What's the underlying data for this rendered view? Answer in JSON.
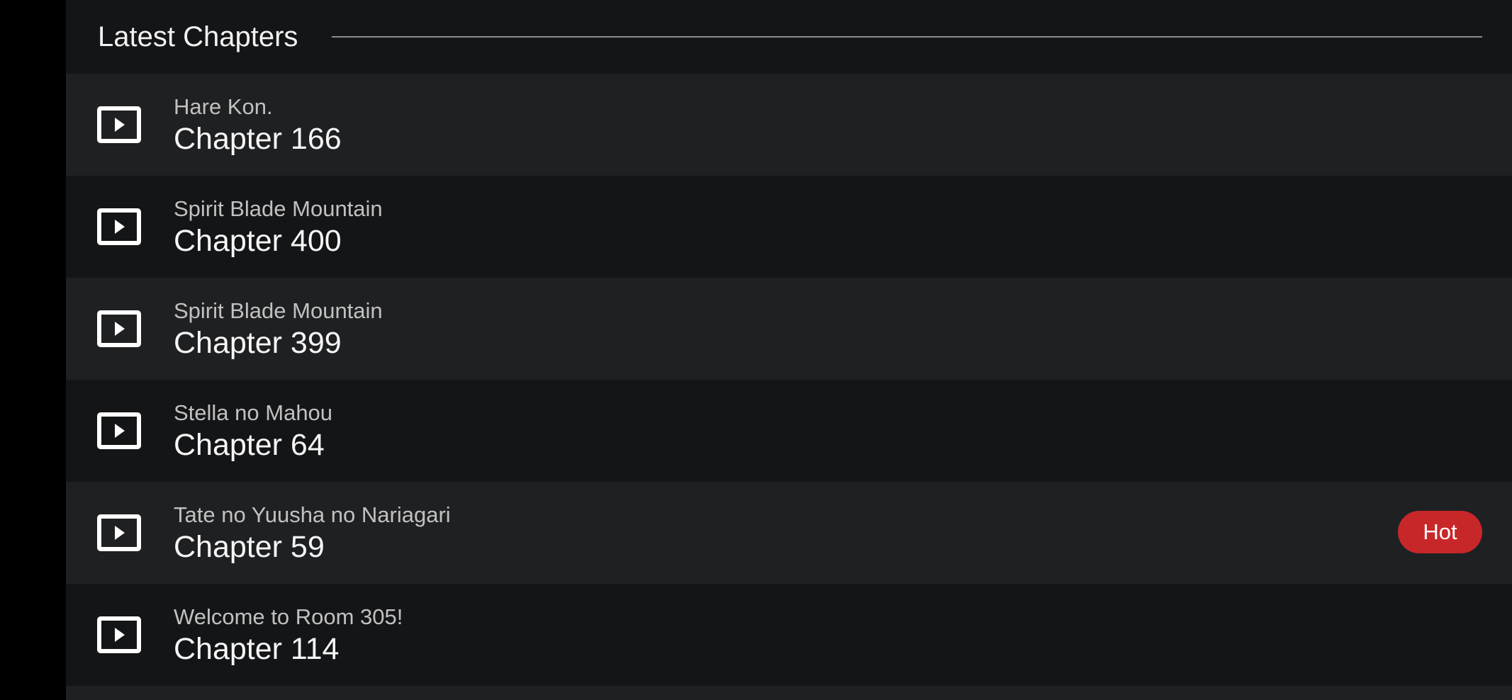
{
  "latest_chapters": {
    "title": "Latest Chapters",
    "items": [
      {
        "series": "Hare Kon.",
        "chapter": "Chapter 166",
        "icon": "play-icon"
      },
      {
        "series": "Spirit Blade Mountain",
        "chapter": "Chapter 400",
        "icon": "play-icon"
      },
      {
        "series": "Spirit Blade Mountain",
        "chapter": "Chapter 399",
        "icon": "play-icon"
      },
      {
        "series": "Stella no Mahou",
        "chapter": "Chapter 64",
        "icon": "play-icon"
      },
      {
        "series": "Tate no Yuusha no Nariagari",
        "chapter": "Chapter 59",
        "icon": "play-icon",
        "badge": "Hot"
      },
      {
        "series": "Welcome to Room 305!",
        "chapter": "Chapter 114",
        "icon": "play-icon"
      }
    ]
  },
  "colors": {
    "background": "#141517",
    "row_alt": "#1f2022",
    "text_primary": "#f6f6f6",
    "text_secondary": "#c1c1c1",
    "hot_badge": "#c8272a",
    "divider": "#8b8b8b"
  }
}
